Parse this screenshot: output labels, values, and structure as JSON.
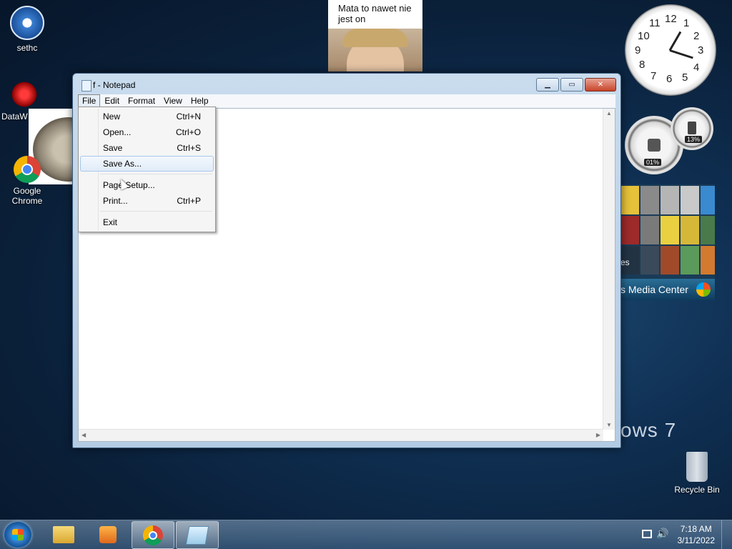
{
  "desktop": {
    "icons": [
      {
        "label": "sethc"
      },
      {
        "label": "DataW"
      },
      {
        "label": "Google Chrome"
      },
      {
        "label": "Recycle Bin"
      }
    ],
    "sticker_caption": "Mata to nawet nie jest on",
    "win7_text": "ows 7"
  },
  "gadgets": {
    "clock_numbers": [
      "12",
      "1",
      "2",
      "3",
      "4",
      "5",
      "6",
      "7",
      "8",
      "9",
      "10",
      "11"
    ],
    "cpu_percent": "01%",
    "memory_percent": "13%",
    "media_center_label": "s Media Center",
    "media_center_side_text": "es"
  },
  "notepad": {
    "title": "f - Notepad",
    "menu": [
      "File",
      "Edit",
      "Format",
      "View",
      "Help"
    ],
    "file_menu": [
      {
        "label": "New",
        "shortcut": "Ctrl+N"
      },
      {
        "label": "Open...",
        "shortcut": "Ctrl+O"
      },
      {
        "label": "Save",
        "shortcut": "Ctrl+S"
      },
      {
        "label": "Save As...",
        "shortcut": ""
      },
      {
        "label": "Page Setup...",
        "shortcut": ""
      },
      {
        "label": "Print...",
        "shortcut": "Ctrl+P"
      },
      {
        "label": "Exit",
        "shortcut": ""
      }
    ],
    "caption_buttons": {
      "minimize": "▁",
      "maximize": "▭",
      "close": "✕"
    }
  },
  "taskbar": {
    "time": "7:18 AM",
    "date": "3/11/2022"
  },
  "colors": {
    "desktop_bg": "#0f2f52",
    "menu_highlight": "#e1ecf8",
    "taskbar": "#5a82a8"
  }
}
